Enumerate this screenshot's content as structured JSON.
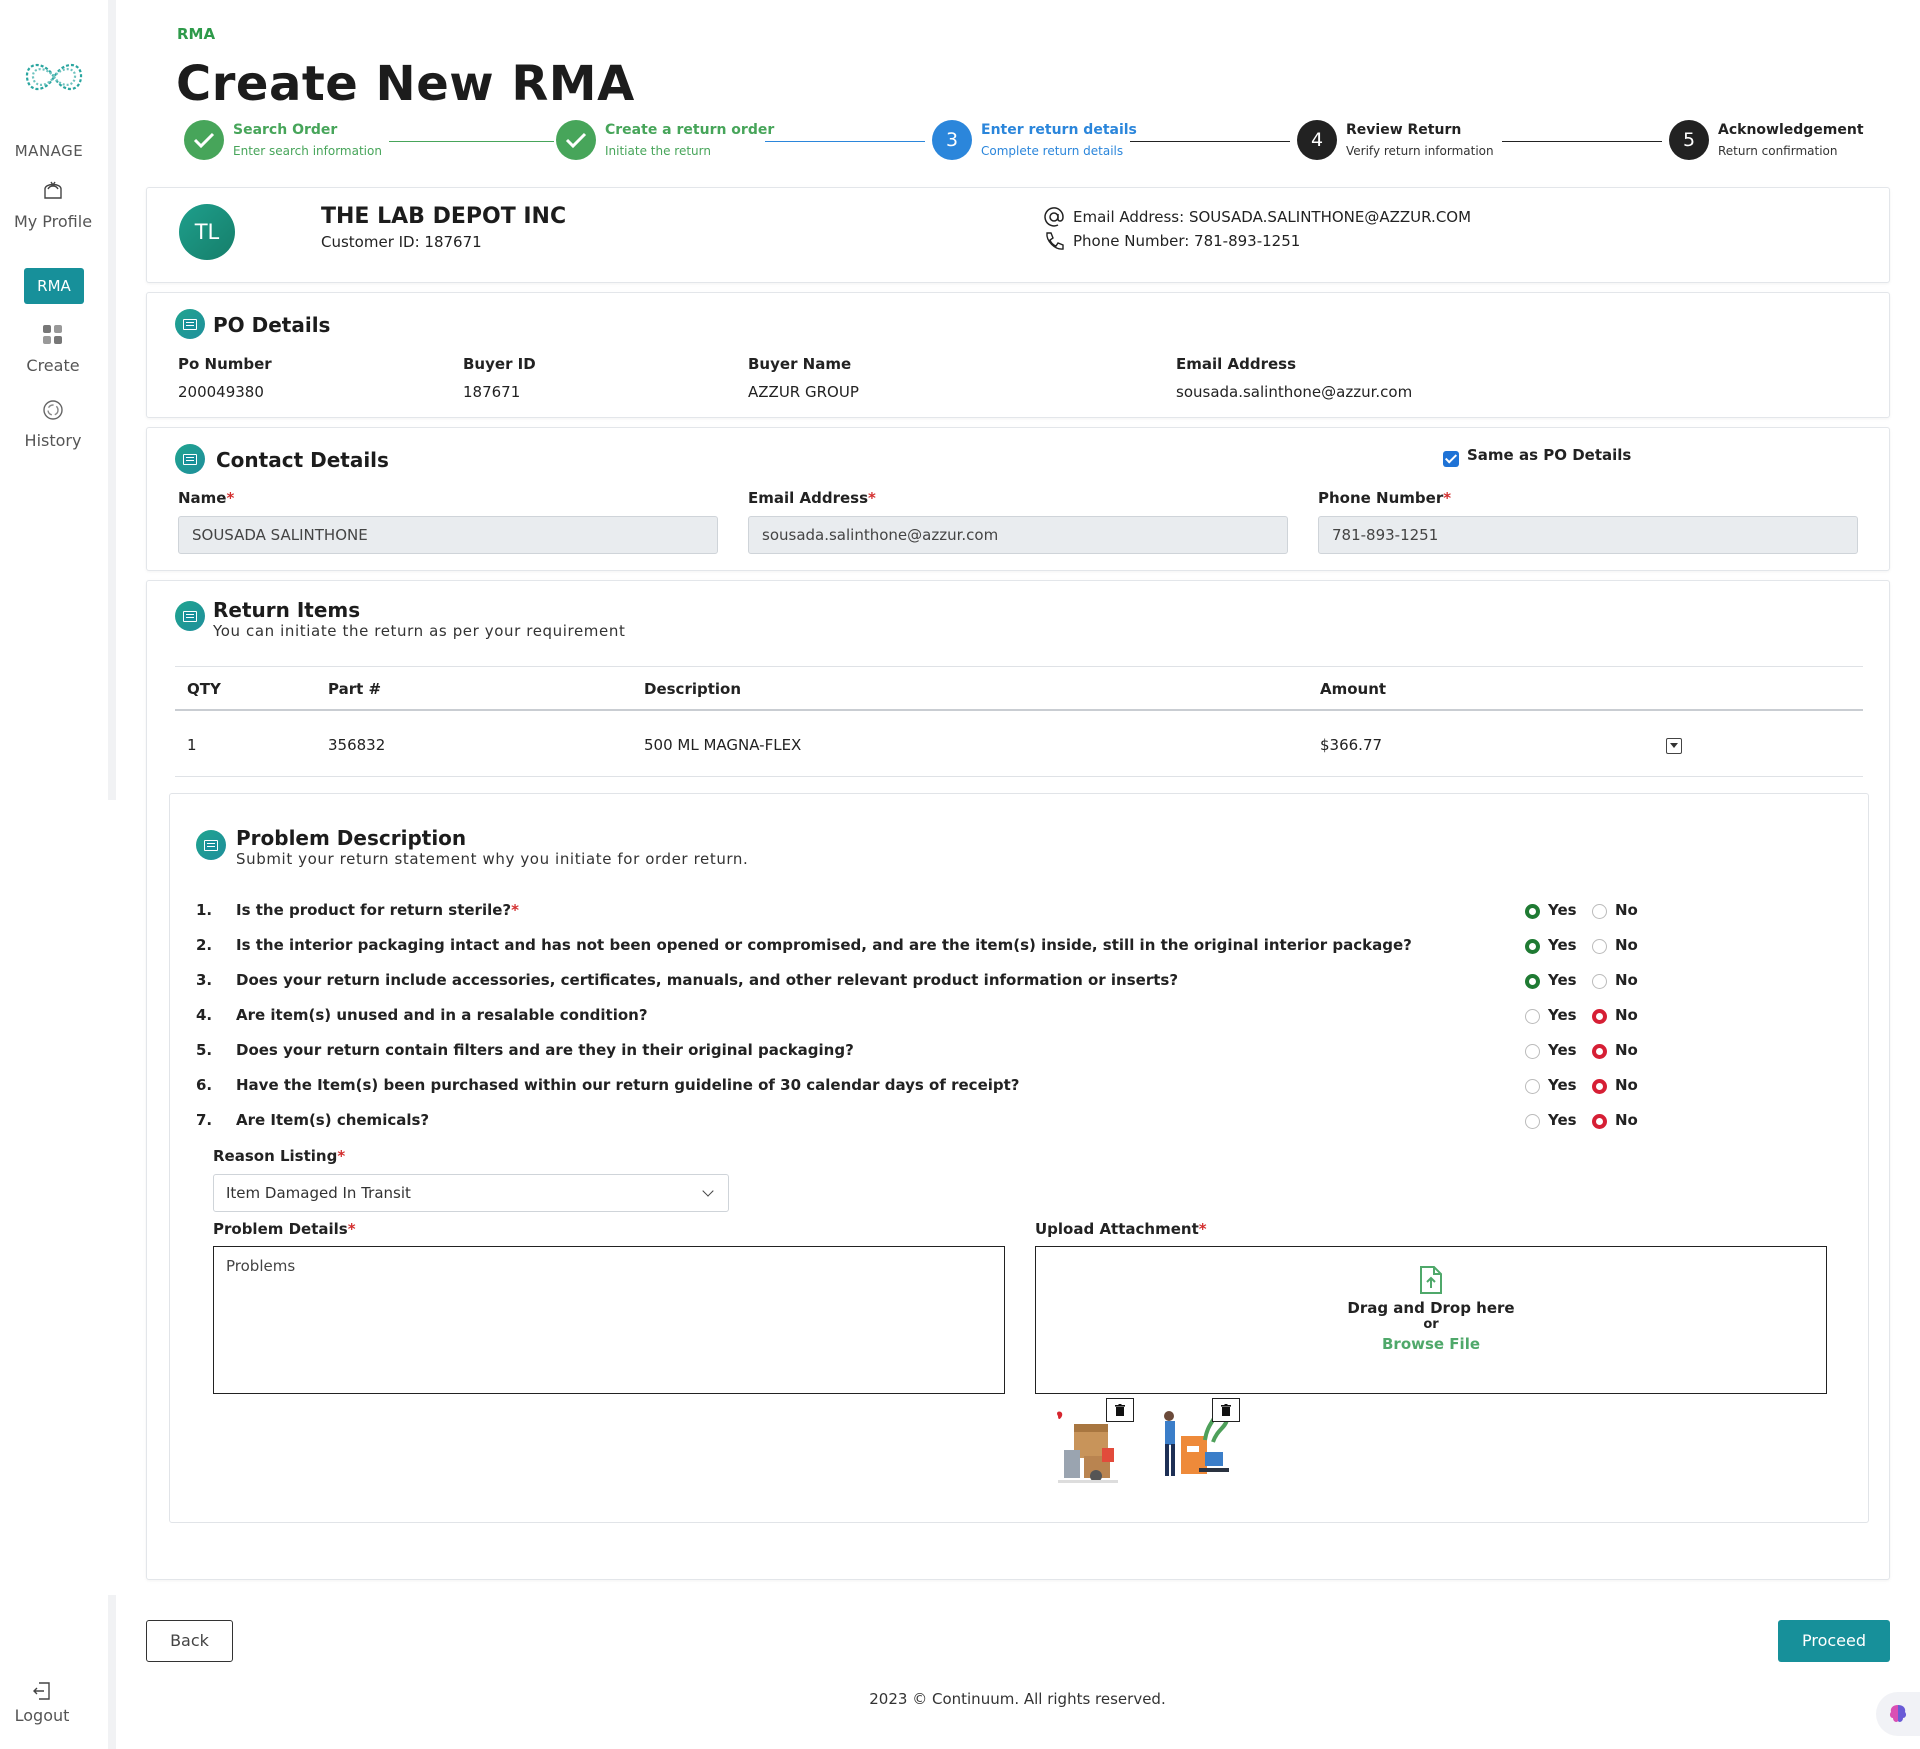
{
  "sidebar": {
    "section_label": "MANAGE",
    "my_profile": "My Profile",
    "rma_label": "RMA",
    "create": "Create",
    "history": "History",
    "logout": "Logout"
  },
  "header": {
    "breadcrumb": "RMA",
    "title": "Create New RMA"
  },
  "stepper": [
    {
      "number": "",
      "title": "Search Order",
      "subtitle": "Enter search information",
      "status": "done"
    },
    {
      "number": "",
      "title": "Create a return order",
      "subtitle": "Initiate the return",
      "status": "done"
    },
    {
      "number": "3",
      "title": "Enter return details",
      "subtitle": "Complete return details",
      "status": "active"
    },
    {
      "number": "4",
      "title": "Review Return",
      "subtitle": "Verify return information",
      "status": "todo"
    },
    {
      "number": "5",
      "title": "Acknowledgement",
      "subtitle": "Return confirmation",
      "status": "todo"
    }
  ],
  "customer": {
    "initials": "TL",
    "name": "THE LAB DEPOT INC",
    "customer_id": "Customer ID: 187671",
    "email": "Email Address: SOUSADA.SALINTHONE@AZZUR.COM",
    "phone": "Phone Number: 781-893-1251"
  },
  "po_details": {
    "title": "PO Details",
    "fields": [
      {
        "label": "Po Number",
        "value": "200049380"
      },
      {
        "label": "Buyer ID",
        "value": "187671"
      },
      {
        "label": "Buyer Name",
        "value": "AZZUR GROUP"
      },
      {
        "label": "Email Address",
        "value": "sousada.salinthone@azzur.com"
      }
    ]
  },
  "contact": {
    "title": "Contact Details",
    "same_as_po": "Same as PO Details",
    "same_as_po_checked": true,
    "name_label": "Name",
    "name_value": "SOUSADA SALINTHONE",
    "email_label": "Email Address",
    "email_value": "sousada.salinthone@azzur.com",
    "phone_label": "Phone Number",
    "phone_value": "781-893-1251",
    "required_mark": "*"
  },
  "return_items": {
    "title": "Return Items",
    "subtitle": "You can initiate the return as per your requirement",
    "columns": [
      "QTY",
      "Part #",
      "Description",
      "Amount"
    ],
    "rows": [
      {
        "qty": "1",
        "part": "356832",
        "description": "500 ML MAGNA-FLEX",
        "amount": "$366.77"
      }
    ]
  },
  "problem": {
    "title": "Problem Description",
    "subtitle": "Submit your return statement why you initiate for order return.",
    "yes_label": "Yes",
    "no_label": "No",
    "questions": [
      {
        "num": "1.",
        "text": "Is the product for return sterile?",
        "required": true,
        "answer": "yes"
      },
      {
        "num": "2.",
        "text": "Is the interior packaging intact and has not been opened or compromised, and are the item(s) inside, still in the original interior package?",
        "required": false,
        "answer": "yes"
      },
      {
        "num": "3.",
        "text": "Does your return include accessories, certificates, manuals, and other relevant product information or inserts?",
        "required": false,
        "answer": "yes"
      },
      {
        "num": "4.",
        "text": "Are item(s) unused and in a resalable condition?",
        "required": false,
        "answer": "no"
      },
      {
        "num": "5.",
        "text": "Does your return contain filters and are they in their original packaging?",
        "required": false,
        "answer": "no"
      },
      {
        "num": "6.",
        "text": "Have the Item(s) been purchased within our return guideline of 30 calendar days of receipt?",
        "required": false,
        "answer": "no"
      },
      {
        "num": "7.",
        "text": "Are Item(s) chemicals?",
        "required": false,
        "answer": "no"
      }
    ],
    "reason_label": "Reason Listing",
    "reason_value": "Item Damaged In Transit",
    "details_label": "Problem Details",
    "details_value": "Problems",
    "upload_label": "Upload Attachment",
    "drag_text": "Drag and Drop here",
    "or_text": "or",
    "browse_text": "Browse File"
  },
  "actions": {
    "back": "Back",
    "proceed": "Proceed"
  },
  "footer": "2023 © Continuum. All rights reserved.",
  "colors": {
    "accent": "#17909a",
    "done": "#47a55a",
    "active": "#2b86db",
    "radio_yes": "#1f7a33",
    "radio_no": "#d61f35"
  }
}
